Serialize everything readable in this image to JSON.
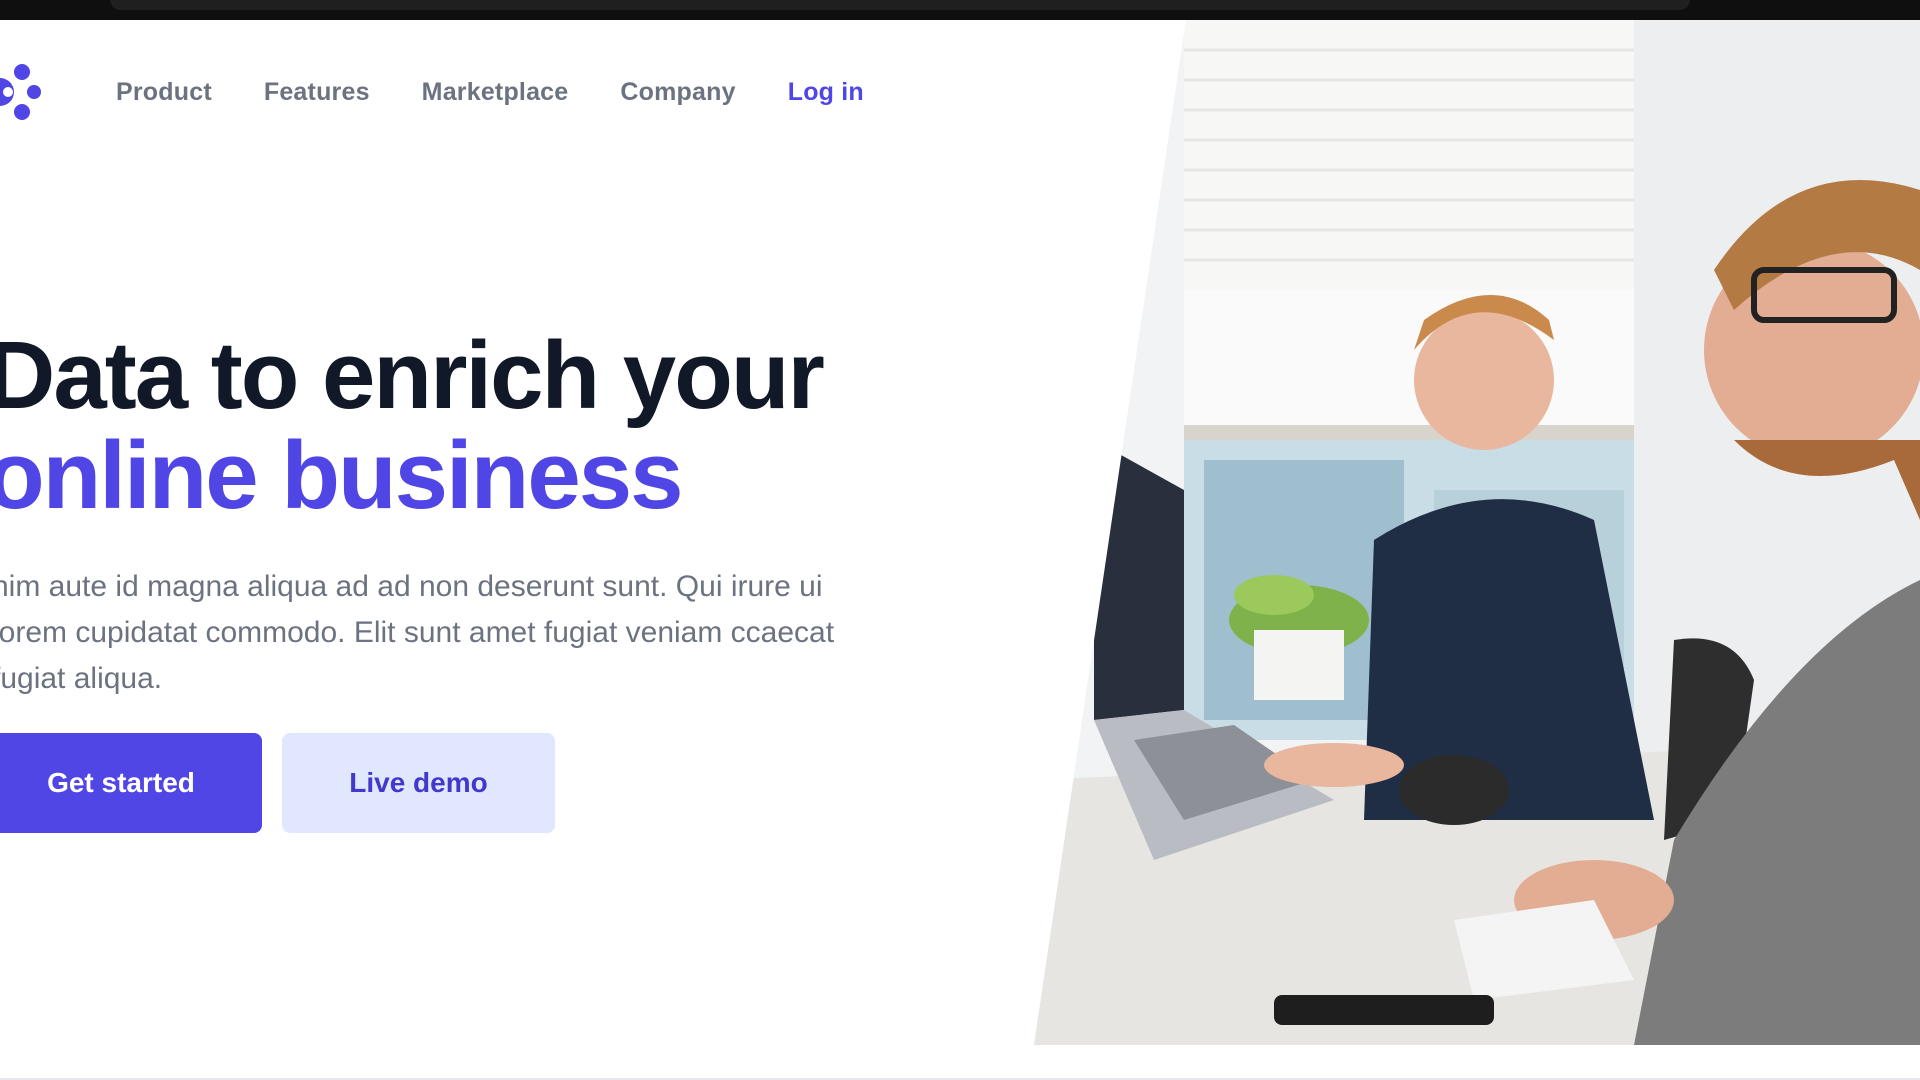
{
  "nav": {
    "items": [
      {
        "label": "Product"
      },
      {
        "label": "Features"
      },
      {
        "label": "Marketplace"
      },
      {
        "label": "Company"
      }
    ],
    "login_label": "Log in"
  },
  "hero": {
    "headline_line1": "Data to enrich your",
    "headline_line2": "online business",
    "description": "nim aute id magna aliqua ad ad non deserunt sunt. Qui irure ui lorem cupidatat commodo. Elit sunt amet fugiat veniam ccaecat fugiat aliqua.",
    "primary_button": "Get started",
    "secondary_button": "Live demo"
  },
  "colors": {
    "accent": "#4f46e5",
    "accent_light": "#e0e7ff",
    "heading": "#111827",
    "muted_text": "#6b7280"
  },
  "icons": {
    "logo": "brand-dots-logo-icon"
  }
}
